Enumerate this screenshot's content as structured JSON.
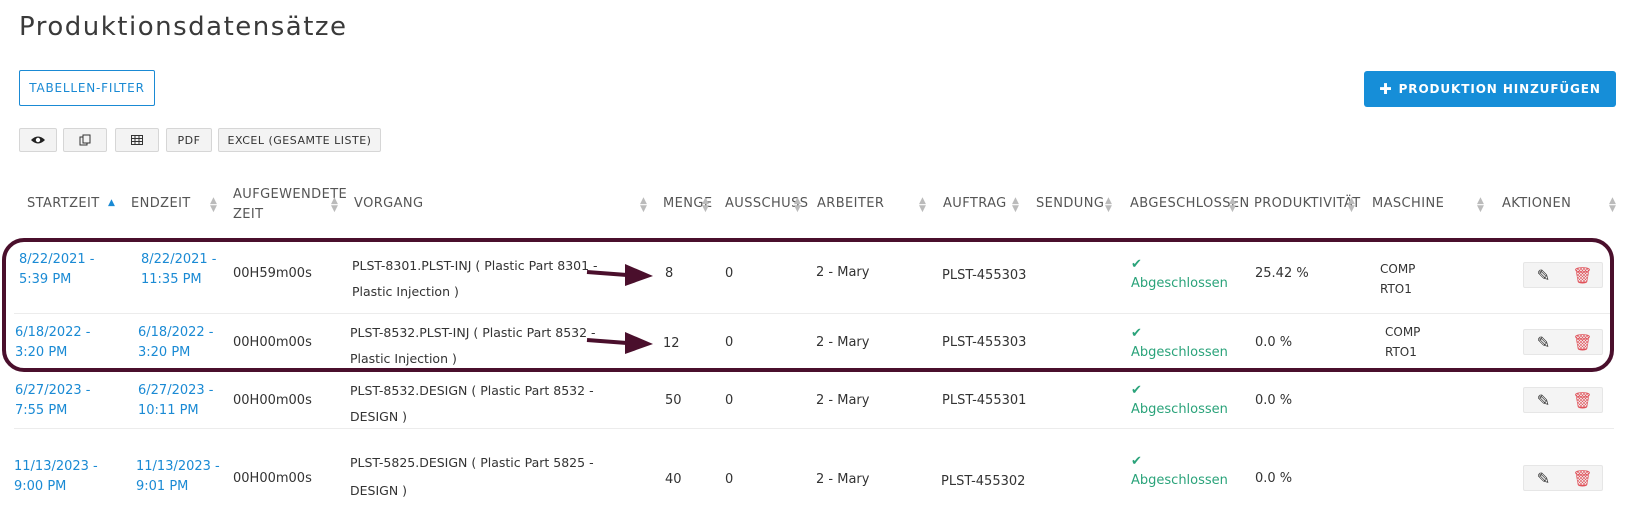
{
  "page": {
    "title": "Produktionsdatensätze"
  },
  "toolbar": {
    "filter_label": "TABELLEN-FILTER",
    "add_label": "PRODUKTION HINZUFÜGEN",
    "pdf_label": "PDF",
    "excel_label": "EXCEL (GESAMTE LISTE)"
  },
  "table": {
    "columns": [
      "STARTZEIT",
      "ENDZEIT",
      "AUFGEWENDETE",
      "ZEIT",
      "VORGANG",
      "MENGE",
      "AUSSCHUSS",
      "ARBEITER",
      "AUFTRAG",
      "SENDUNG",
      "ABGESCHLOSSEN",
      "PRODUKTIVITÄT",
      "MASCHINE",
      "AKTIONEN"
    ],
    "rows": [
      {
        "start1": "8/22/2021 -",
        "start2": "5:39 PM",
        "end1": "8/22/2021 -",
        "end2": "11:35 PM",
        "spent": "00H59m00s",
        "op1": "PLST-8301.PLST-INJ ( Plastic Part 8301 -",
        "op2": "Plastic Injection )",
        "qty": "8",
        "scrap": "0",
        "worker": "2 - Mary",
        "order": "PLST-455303",
        "done": "Abgeschlossen",
        "prod": "25.42 %",
        "m1": "COMP",
        "m2": "RTO1"
      },
      {
        "start1": "6/18/2022 -",
        "start2": "3:20 PM",
        "end1": "6/18/2022 -",
        "end2": "3:20 PM",
        "spent": "00H00m00s",
        "op1": "PLST-8532.PLST-INJ ( Plastic Part 8532 -",
        "op2": "Plastic Injection )",
        "qty": "12",
        "scrap": "0",
        "worker": "2 - Mary",
        "order": "PLST-455303",
        "done": "Abgeschlossen",
        "prod": "0.0 %",
        "m1": "COMP",
        "m2": "RTO1"
      },
      {
        "start1": "6/27/2023 -",
        "start2": "7:55 PM",
        "end1": "6/27/2023 -",
        "end2": "10:11 PM",
        "spent": "00H00m00s",
        "op1": "PLST-8532.DESIGN ( Plastic Part 8532 -",
        "op2": "DESIGN )",
        "qty": "50",
        "scrap": "0",
        "worker": "2 - Mary",
        "order": "PLST-455301",
        "done": "Abgeschlossen",
        "prod": "0.0 %",
        "m1": "",
        "m2": ""
      },
      {
        "start1": "11/13/2023 -",
        "start2": "9:00 PM",
        "end1": "11/13/2023 -",
        "end2": "9:01 PM",
        "spent": "00H00m00s",
        "op1": "PLST-5825.DESIGN ( Plastic Part 5825 -",
        "op2": "DESIGN )",
        "qty": "40",
        "scrap": "0",
        "worker": "2 - Mary",
        "order": "PLST-455302",
        "done": "Abgeschlossen",
        "prod": "0.0 %",
        "m1": "",
        "m2": ""
      }
    ]
  },
  "icons": [
    "eye-icon",
    "copy-icon",
    "table-icon",
    "plus-icon",
    "sort-asc-icon",
    "sort-icon",
    "check-icon",
    "edit-icon",
    "trash-icon",
    "arrow-icon"
  ],
  "colors": {
    "accent": "#168ed8",
    "link": "#1a8ad4",
    "success": "#2aa37a",
    "danger": "#e0525a",
    "highlight": "#4a0f2c"
  }
}
